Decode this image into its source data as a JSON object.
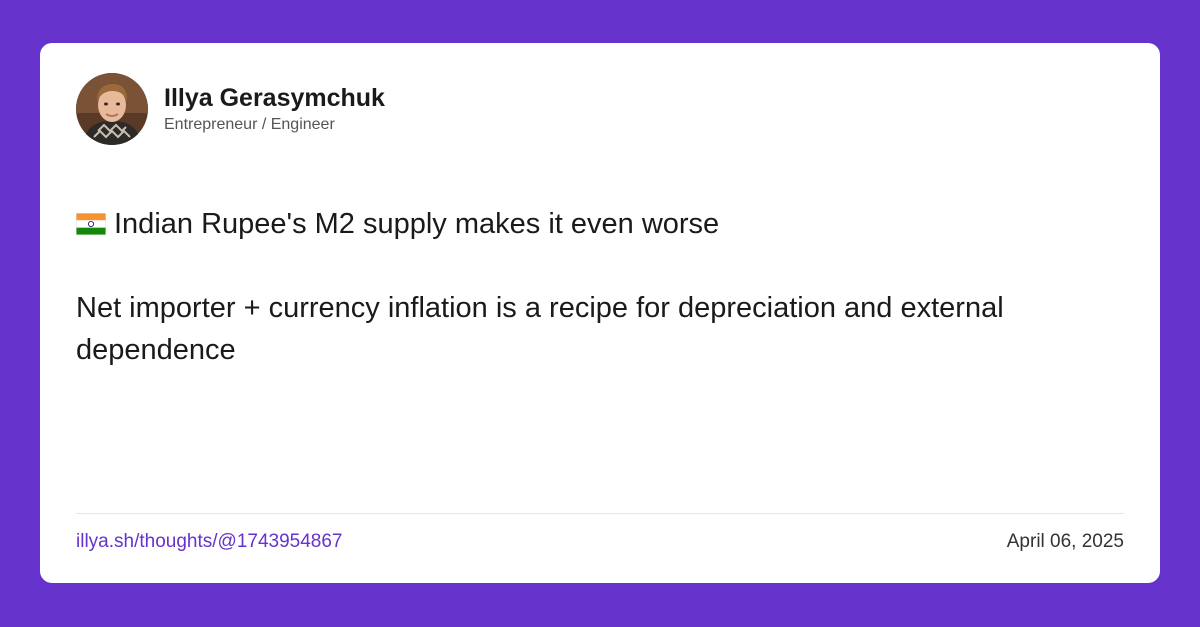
{
  "author": {
    "name": "Illya Gerasymchuk",
    "role": "Entrepreneur / Engineer"
  },
  "post": {
    "flag_icon": "india-flag-icon",
    "line1": "Indian Rupee's M2 supply makes it even worse",
    "line2": "Net importer + currency inflation is a recipe for depreciation and external dependence"
  },
  "footer": {
    "link": "illya.sh/thoughts/@1743954867",
    "date": "April 06, 2025"
  },
  "colors": {
    "background": "#6633cc",
    "card": "#ffffff",
    "link": "#6633cc",
    "text": "#1a1a1a"
  }
}
